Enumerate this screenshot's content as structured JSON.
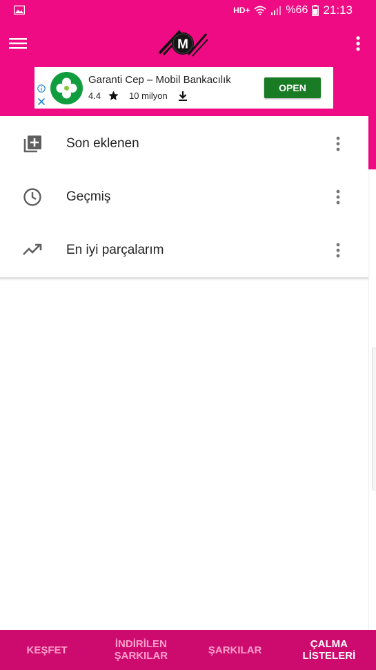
{
  "status_bar": {
    "network": "HD+",
    "battery": "%66",
    "time": "21:13",
    "icons": [
      "gallery-icon",
      "wifi-icon",
      "signal-icon",
      "battery-icon"
    ]
  },
  "app_bar": {
    "logo_letter": "M",
    "icons": [
      "menu-icon",
      "more-vertical-icon"
    ],
    "colors": {
      "primary": "#ef0b83",
      "nav": "#cd0b6f"
    }
  },
  "ad": {
    "title": "Garanti Cep – Mobil Bankacılık",
    "rating": "4.4",
    "downloads": "10 milyon",
    "cta": "OPEN",
    "icons": [
      "info-icon",
      "close-icon",
      "clover-icon",
      "star-icon",
      "download-icon"
    ]
  },
  "playlists": [
    {
      "label": "Son eklenen",
      "icon": "playlist-add-icon"
    },
    {
      "label": "Geçmiş",
      "icon": "history-icon"
    },
    {
      "label": "En iyi parçalarım",
      "icon": "trending-up-icon"
    }
  ],
  "bottom_nav": {
    "tabs": [
      {
        "line1": "KEŞFET",
        "line2": "",
        "active": false
      },
      {
        "line1": "İNDİRİLEN",
        "line2": "ŞARKILAR",
        "active": false
      },
      {
        "line1": "ŞARKILAR",
        "line2": "",
        "active": false
      },
      {
        "line1": "ÇALMA",
        "line2": "LİSTELERİ",
        "active": true
      }
    ]
  }
}
